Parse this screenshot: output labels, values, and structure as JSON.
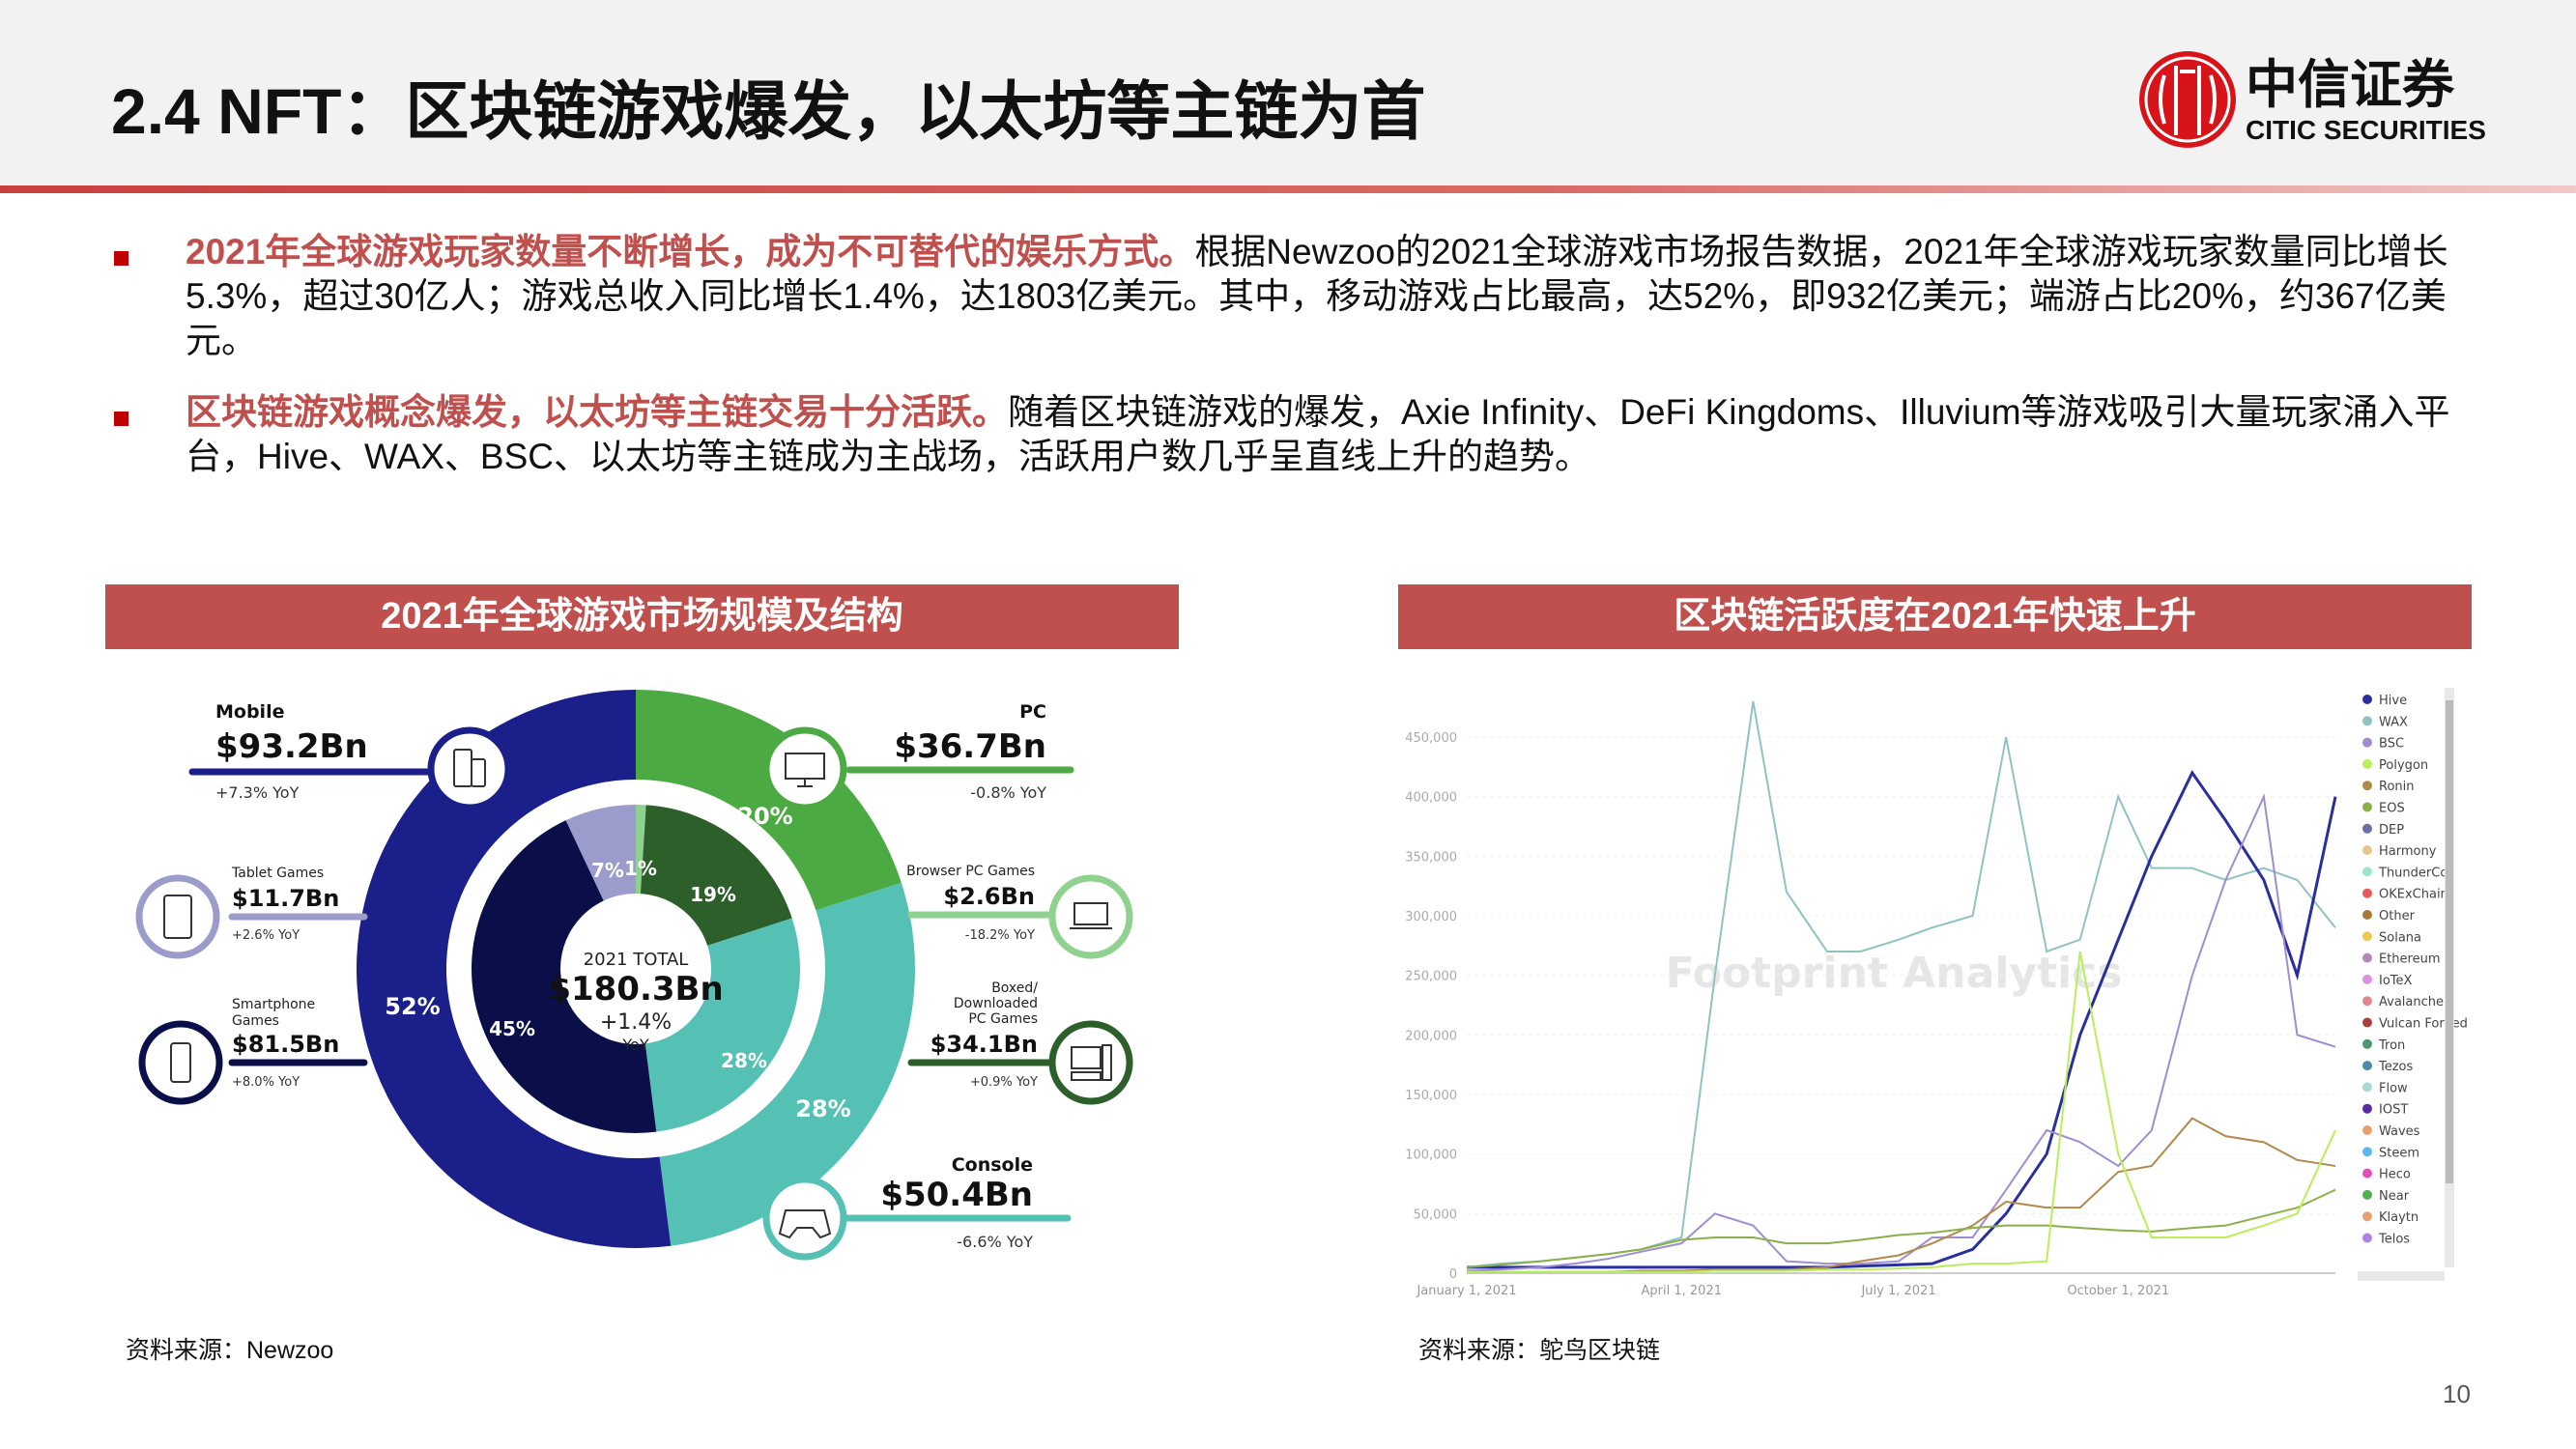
{
  "header": {
    "title": "2.4 NFT：区块链游戏爆发，以太坊等主链为首",
    "logo": {
      "cn": "中信证券",
      "en": "CITIC SECURITIES",
      "color": "#d7141a"
    }
  },
  "bullets": [
    {
      "highlight": "2021年全球游戏玩家数量不断增长，成为不可替代的娱乐方式。",
      "text": "根据Newzoo的2021全球游戏市场报告数据，2021年全球游戏玩家数量同比增长5.3%，超过30亿人；游戏总收入同比增长1.4%，达1803亿美元。其中，移动游戏占比最高，达52%，即932亿美元；端游占比20%，约367亿美元。"
    },
    {
      "highlight": "区块链游戏概念爆发，以太坊等主链交易十分活跃。",
      "text": "随着区块链游戏的爆发，Axie Infinity、DeFi Kingdoms、Illuvium等游戏吸引大量玩家涌入平台，Hive、WAX、BSC、以太坊等主链成为主战场，活跃用户数几乎呈直线上升的趋势。"
    }
  ],
  "left_panel": {
    "title": "2021年全球游戏市场规模及结构",
    "source": "资料来源：Newzoo"
  },
  "right_panel": {
    "title": "区块链活跃度在2021年快速上升",
    "source": "资料来源：鸵鸟区块链"
  },
  "page_number": "10",
  "chart_data": [
    {
      "type": "pie",
      "center": {
        "line1": "2021 TOTAL",
        "total": "$180.3Bn",
        "yoy": "+1.4%",
        "yoy_unit": "YoY"
      },
      "outer": [
        {
          "name": "PC",
          "value": "$36.7Bn",
          "yoy": "-0.8% YoY",
          "pct": 20,
          "label": "20%",
          "color": "#4caa43",
          "icon": "monitor-icon"
        },
        {
          "name": "Console",
          "value": "$50.4Bn",
          "yoy": "-6.6% YoY",
          "pct": 28,
          "label": "28%",
          "color": "#55c1b4",
          "icon": "gamepad-icon"
        },
        {
          "name": "Mobile",
          "value": "$93.2Bn",
          "yoy": "+7.3% YoY",
          "pct": 52,
          "label": "52%",
          "color": "#1b1f8a",
          "icon": "phone-tablet-icon"
        }
      ],
      "inner": [
        {
          "name": "Browser PC Games",
          "value": "$2.6Bn",
          "yoy": "-18.2% YoY",
          "pct": 1,
          "label": "1%",
          "color": "#8fd18f",
          "icon": "laptop-icon"
        },
        {
          "name": "Boxed/ Downloaded PC Games",
          "name_lines": [
            "Boxed/",
            "Downloaded",
            "PC Games"
          ],
          "value": "$34.1Bn",
          "yoy": "+0.9% YoY",
          "pct": 19,
          "label": "19%",
          "color": "#2d5f2a",
          "icon": "desktop-icon"
        },
        {
          "name": "Console",
          "pct": 28,
          "label": "28%",
          "color": "#55c1b4"
        },
        {
          "name": "Smartphone Games",
          "name_lines": [
            "Smartphone",
            "Games"
          ],
          "value": "$81.5Bn",
          "yoy": "+8.0% YoY",
          "pct": 45,
          "label": "45%",
          "color": "#0a0f4a",
          "icon": "smartphone-icon"
        },
        {
          "name": "Tablet Games",
          "value": "$11.7Bn",
          "yoy": "+2.6% YoY",
          "pct": 7,
          "label": "7%",
          "color": "#9c9ccc",
          "icon": "tablet-icon"
        }
      ]
    },
    {
      "type": "line",
      "ylim": [
        0,
        500000
      ],
      "yticks": [
        0,
        50000,
        100000,
        150000,
        200000,
        250000,
        300000,
        350000,
        400000,
        450000
      ],
      "ytick_labels": [
        "0",
        "50,000",
        "100,000",
        "150,000",
        "200,000",
        "250,000",
        "300,000",
        "350,000",
        "400,000",
        "450,000"
      ],
      "xticks": [
        "2021-01-01",
        "2021-04-01",
        "2021-07-01",
        "2021-10-01"
      ],
      "xtick_labels": [
        "January 1, 2021",
        "April 1, 2021",
        "July 1, 2021",
        "October 1, 2021"
      ],
      "watermark": "Footprint Analytics",
      "grid": true,
      "legend_placement": "right",
      "x": [
        "2021-01-01",
        "2021-01-15",
        "2021-02-01",
        "2021-02-15",
        "2021-03-01",
        "2021-03-15",
        "2021-04-01",
        "2021-04-15",
        "2021-05-01",
        "2021-05-15",
        "2021-06-01",
        "2021-06-15",
        "2021-07-01",
        "2021-07-15",
        "2021-08-01",
        "2021-08-15",
        "2021-09-01",
        "2021-09-15",
        "2021-10-01",
        "2021-10-15",
        "2021-11-01",
        "2021-11-15",
        "2021-12-01",
        "2021-12-15",
        "2021-12-31"
      ],
      "series": [
        {
          "name": "WAX",
          "color": "#8fc3c3",
          "values": [
            5000,
            8000,
            10000,
            13000,
            16000,
            20000,
            30000,
            250000,
            480000,
            320000,
            270000,
            270000,
            280000,
            290000,
            300000,
            450000,
            270000,
            280000,
            400000,
            340000,
            340000,
            330000,
            340000,
            330000,
            290000
          ]
        },
        {
          "name": "Hive",
          "color": "#2a2fa0",
          "values": [
            5000,
            5000,
            5000,
            5000,
            5000,
            5000,
            5000,
            5000,
            5000,
            5000,
            5000,
            6000,
            7000,
            8000,
            20000,
            50000,
            100000,
            200000,
            280000,
            350000,
            420000,
            380000,
            330000,
            250000,
            400000
          ]
        },
        {
          "name": "BSC",
          "color": "#a08cd0",
          "values": [
            2000,
            3000,
            5000,
            8000,
            12000,
            18000,
            25000,
            50000,
            40000,
            10000,
            8000,
            8000,
            10000,
            30000,
            30000,
            70000,
            120000,
            110000,
            90000,
            120000,
            250000,
            330000,
            400000,
            200000,
            190000
          ]
        },
        {
          "name": "Ronin",
          "color": "#b08a4a",
          "values": [
            1000,
            1000,
            1000,
            1000,
            1000,
            2000,
            2000,
            3000,
            3000,
            3000,
            5000,
            10000,
            15000,
            25000,
            40000,
            60000,
            55000,
            55000,
            85000,
            90000,
            130000,
            115000,
            110000,
            95000,
            90000
          ]
        },
        {
          "name": "EOS",
          "color": "#8ab04a",
          "values": [
            5000,
            7000,
            10000,
            13000,
            16000,
            20000,
            28000,
            30000,
            30000,
            25000,
            25000,
            28000,
            32000,
            34000,
            38000,
            40000,
            40000,
            38000,
            36000,
            35000,
            38000,
            40000,
            48000,
            55000,
            70000
          ]
        },
        {
          "name": "Polygon",
          "color": "#b8ef5a",
          "values": [
            1000,
            1000,
            1000,
            1000,
            1000,
            1000,
            1000,
            2000,
            2000,
            2000,
            3000,
            3000,
            4000,
            5000,
            8000,
            8000,
            10000,
            270000,
            100000,
            30000,
            30000,
            30000,
            40000,
            50000,
            120000
          ]
        }
      ],
      "legend": [
        {
          "name": "Hive",
          "color": "#2a2fa0"
        },
        {
          "name": "WAX",
          "color": "#8fc3c3"
        },
        {
          "name": "BSC",
          "color": "#a08cd0"
        },
        {
          "name": "Polygon",
          "color": "#b8ef5a"
        },
        {
          "name": "Ronin",
          "color": "#b08a4a"
        },
        {
          "name": "EOS",
          "color": "#8ab04a"
        },
        {
          "name": "DEP",
          "color": "#6a6fa8"
        },
        {
          "name": "Harmony",
          "color": "#e8c88a"
        },
        {
          "name": "ThunderCc",
          "color": "#9ee6c8"
        },
        {
          "name": "OKExChain",
          "color": "#e85a5a"
        },
        {
          "name": "Other",
          "color": "#a87838"
        },
        {
          "name": "Solana",
          "color": "#f0c850"
        },
        {
          "name": "Ethereum",
          "color": "#b888b8"
        },
        {
          "name": "IoTeX",
          "color": "#e090e0"
        },
        {
          "name": "Avalanche",
          "color": "#e08888"
        },
        {
          "name": "Vulcan Forged",
          "color": "#a84040"
        },
        {
          "name": "Tron",
          "color": "#4a9a70"
        },
        {
          "name": "Tezos",
          "color": "#4a8aa8"
        },
        {
          "name": "Flow",
          "color": "#a8d8d8"
        },
        {
          "name": "IOST",
          "color": "#5a2aa0"
        },
        {
          "name": "Waves",
          "color": "#e8a070"
        },
        {
          "name": "Steem",
          "color": "#60b8e8"
        },
        {
          "name": "Heco",
          "color": "#e050b8"
        },
        {
          "name": "Near",
          "color": "#50b050"
        },
        {
          "name": "Klaytn",
          "color": "#e8a070"
        },
        {
          "name": "Telos",
          "color": "#b080e8"
        }
      ]
    }
  ]
}
